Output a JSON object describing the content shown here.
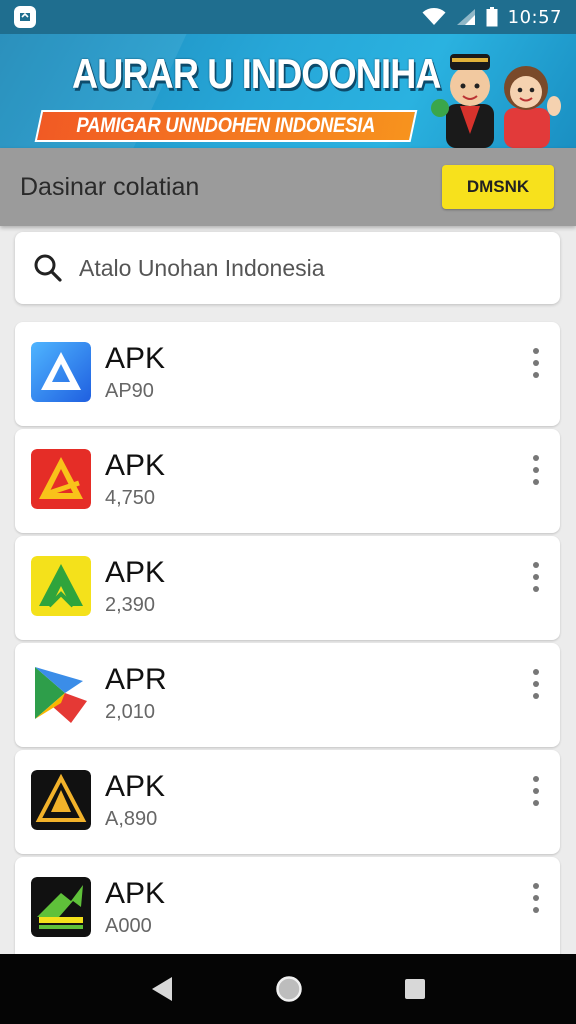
{
  "status_bar": {
    "time": "10:57",
    "icons": [
      "app-notification-icon",
      "wifi-icon",
      "signal-icon",
      "battery-icon"
    ]
  },
  "banner": {
    "title": "AURAR U INDOONIHA",
    "subtitle": "PAMIGAR UNNDOHEN INDONESIA",
    "colors": {
      "background": "#27a7d8",
      "ribbon": "#f15a24"
    }
  },
  "toolbar": {
    "title": "Dasinar colatian",
    "button_label": "DMSNK",
    "button_color": "#f7e11c"
  },
  "search": {
    "placeholder": "Atalo Unohan Indonesia"
  },
  "apps": [
    {
      "title": "APK",
      "subtitle": "AP90",
      "icon": "blue-triangle-app-icon"
    },
    {
      "title": "APK",
      "subtitle": "4,750",
      "icon": "red-triangle-app-icon"
    },
    {
      "title": "APK",
      "subtitle": "2,390",
      "icon": "green-yellow-app-icon"
    },
    {
      "title": "APR",
      "subtitle": "2,010",
      "icon": "play-style-app-icon"
    },
    {
      "title": "APK",
      "subtitle": "A,890",
      "icon": "black-gold-triangle-app-icon"
    },
    {
      "title": "APK",
      "subtitle": "A000",
      "icon": "black-green-arrow-app-icon"
    }
  ],
  "nav_bar": {
    "icons": [
      "back-icon",
      "home-icon",
      "recents-icon"
    ]
  }
}
